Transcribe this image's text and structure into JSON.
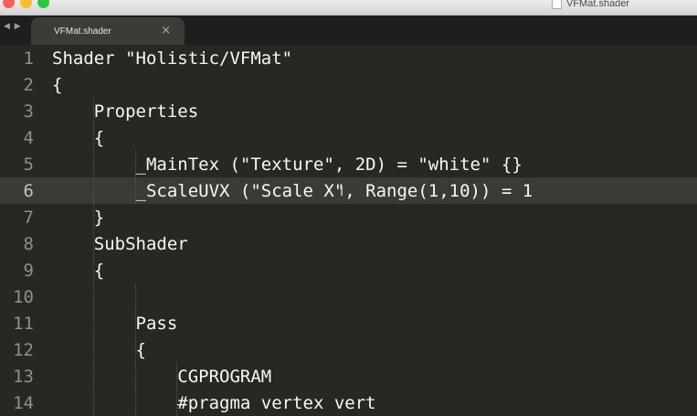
{
  "window": {
    "title": "VFMat.shader"
  },
  "tabs": [
    {
      "label": "VFMat.shader",
      "close": "×"
    }
  ],
  "nav": {
    "arrows": "◀ ▶"
  },
  "editor": {
    "current_line": 6,
    "lines": [
      {
        "n": "1",
        "text": "Shader \"Holistic/VFMat\""
      },
      {
        "n": "2",
        "text": "{"
      },
      {
        "n": "3",
        "text": "    Properties"
      },
      {
        "n": "4",
        "text": "    {"
      },
      {
        "n": "5",
        "text": "        _MainTex (\"Texture\", 2D) = \"white\" {}"
      },
      {
        "n": "6",
        "text": "        _ScaleUVX (\"Scale X\", Range(1,10)) = 1"
      },
      {
        "n": "7",
        "text": "    }"
      },
      {
        "n": "8",
        "text": "    SubShader"
      },
      {
        "n": "9",
        "text": "    {"
      },
      {
        "n": "10",
        "text": ""
      },
      {
        "n": "11",
        "text": "        Pass"
      },
      {
        "n": "12",
        "text": "        {"
      },
      {
        "n": "13",
        "text": "            CGPROGRAM"
      },
      {
        "n": "14",
        "text": "            #pragma vertex vert"
      }
    ]
  }
}
